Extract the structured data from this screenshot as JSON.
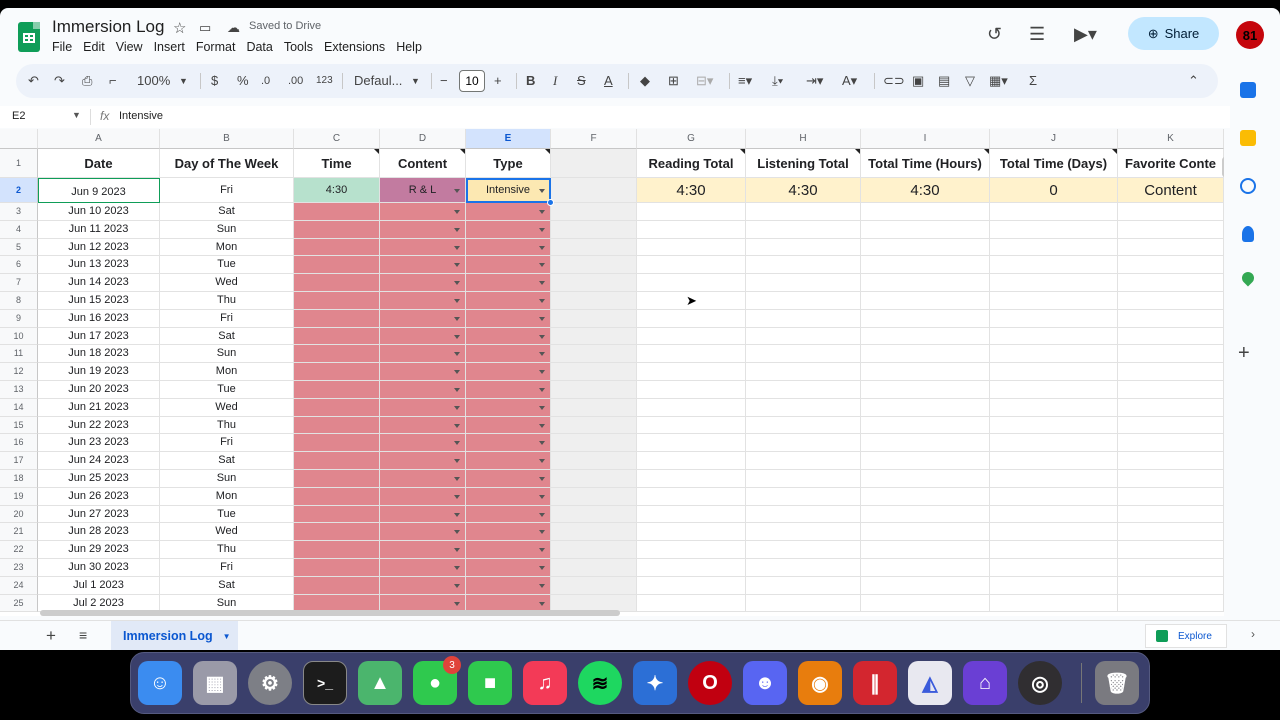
{
  "doc": {
    "title": "Immersion Log",
    "saved_status": "Saved to Drive",
    "menu": [
      "File",
      "Edit",
      "View",
      "Insert",
      "Format",
      "Data",
      "Tools",
      "Extensions",
      "Help"
    ],
    "share_label": "Share",
    "avatar_initials": "81"
  },
  "toolbar": {
    "zoom": "100%",
    "currency": "$",
    "percent": "%",
    "dec_decrease": ".0",
    "dec_increase": ".00",
    "number_format": "123",
    "font": "Defaul...",
    "font_size": "10"
  },
  "formula_bar": {
    "cell_ref": "E2",
    "fx": "fx",
    "content": "Intensive"
  },
  "columns": [
    "A",
    "B",
    "C",
    "D",
    "E",
    "F",
    "G",
    "H",
    "I",
    "J",
    "K"
  ],
  "headers": {
    "date": "Date",
    "day": "Day of The Week",
    "time": "Time",
    "content": "Content",
    "type": "Type",
    "reading_total": "Reading Total",
    "listening_total": "Listening Total",
    "total_hours": "Total Time (Hours)",
    "total_days": "Total Time (Days)",
    "favorite": "Favorite Conte"
  },
  "row2": {
    "time": "4:30",
    "content": "R & L",
    "type": "Intensive",
    "reading_total": "4:30",
    "listening_total": "4:30",
    "total_hours": "4:30",
    "total_days": "0",
    "favorite": "Content"
  },
  "rows": [
    {
      "n": "2",
      "date": "Jun 9 2023",
      "day": "Fri"
    },
    {
      "n": "3",
      "date": "Jun 10 2023",
      "day": "Sat"
    },
    {
      "n": "4",
      "date": "Jun 11 2023",
      "day": "Sun"
    },
    {
      "n": "5",
      "date": "Jun 12 2023",
      "day": "Mon"
    },
    {
      "n": "6",
      "date": "Jun 13 2023",
      "day": "Tue"
    },
    {
      "n": "7",
      "date": "Jun 14 2023",
      "day": "Wed"
    },
    {
      "n": "8",
      "date": "Jun 15 2023",
      "day": "Thu"
    },
    {
      "n": "9",
      "date": "Jun 16 2023",
      "day": "Fri"
    },
    {
      "n": "10",
      "date": "Jun 17 2023",
      "day": "Sat"
    },
    {
      "n": "11",
      "date": "Jun 18 2023",
      "day": "Sun"
    },
    {
      "n": "12",
      "date": "Jun 19 2023",
      "day": "Mon"
    },
    {
      "n": "13",
      "date": "Jun 20 2023",
      "day": "Tue"
    },
    {
      "n": "14",
      "date": "Jun 21 2023",
      "day": "Wed"
    },
    {
      "n": "15",
      "date": "Jun 22 2023",
      "day": "Thu"
    },
    {
      "n": "16",
      "date": "Jun 23 2023",
      "day": "Fri"
    },
    {
      "n": "17",
      "date": "Jun 24 2023",
      "day": "Sat"
    },
    {
      "n": "18",
      "date": "Jun 25 2023",
      "day": "Sun"
    },
    {
      "n": "19",
      "date": "Jun 26 2023",
      "day": "Mon"
    },
    {
      "n": "20",
      "date": "Jun 27 2023",
      "day": "Tue"
    },
    {
      "n": "21",
      "date": "Jun 28 2023",
      "day": "Wed"
    },
    {
      "n": "22",
      "date": "Jun 29 2023",
      "day": "Thu"
    },
    {
      "n": "23",
      "date": "Jun 30 2023",
      "day": "Fri"
    },
    {
      "n": "24",
      "date": "Jul 1 2023",
      "day": "Sat"
    },
    {
      "n": "25",
      "date": "Jul 2 2023",
      "day": "Sun"
    }
  ],
  "sheet_tab": "Immersion Log",
  "explore_label": "Explore",
  "dock": {
    "messages_badge": "3",
    "apps": [
      "finder-icon",
      "launchpad-icon",
      "system-settings-icon",
      "terminal-icon",
      "maps-icon",
      "messages-icon",
      "facetime-icon",
      "music-icon",
      "spotify-icon",
      "xcode-icon",
      "opera-icon",
      "discord-icon",
      "blender-icon",
      "parallels-icon",
      "affinity-icon",
      "home-icon",
      "obs-icon",
      "trash-icon"
    ]
  },
  "colors": {
    "time_cell": "#b7e1cd",
    "content_cell": "#c27ba0",
    "type_cell": "#fce8b2",
    "empty_input": "#e0868e",
    "totals_row": "#fff2cc"
  }
}
